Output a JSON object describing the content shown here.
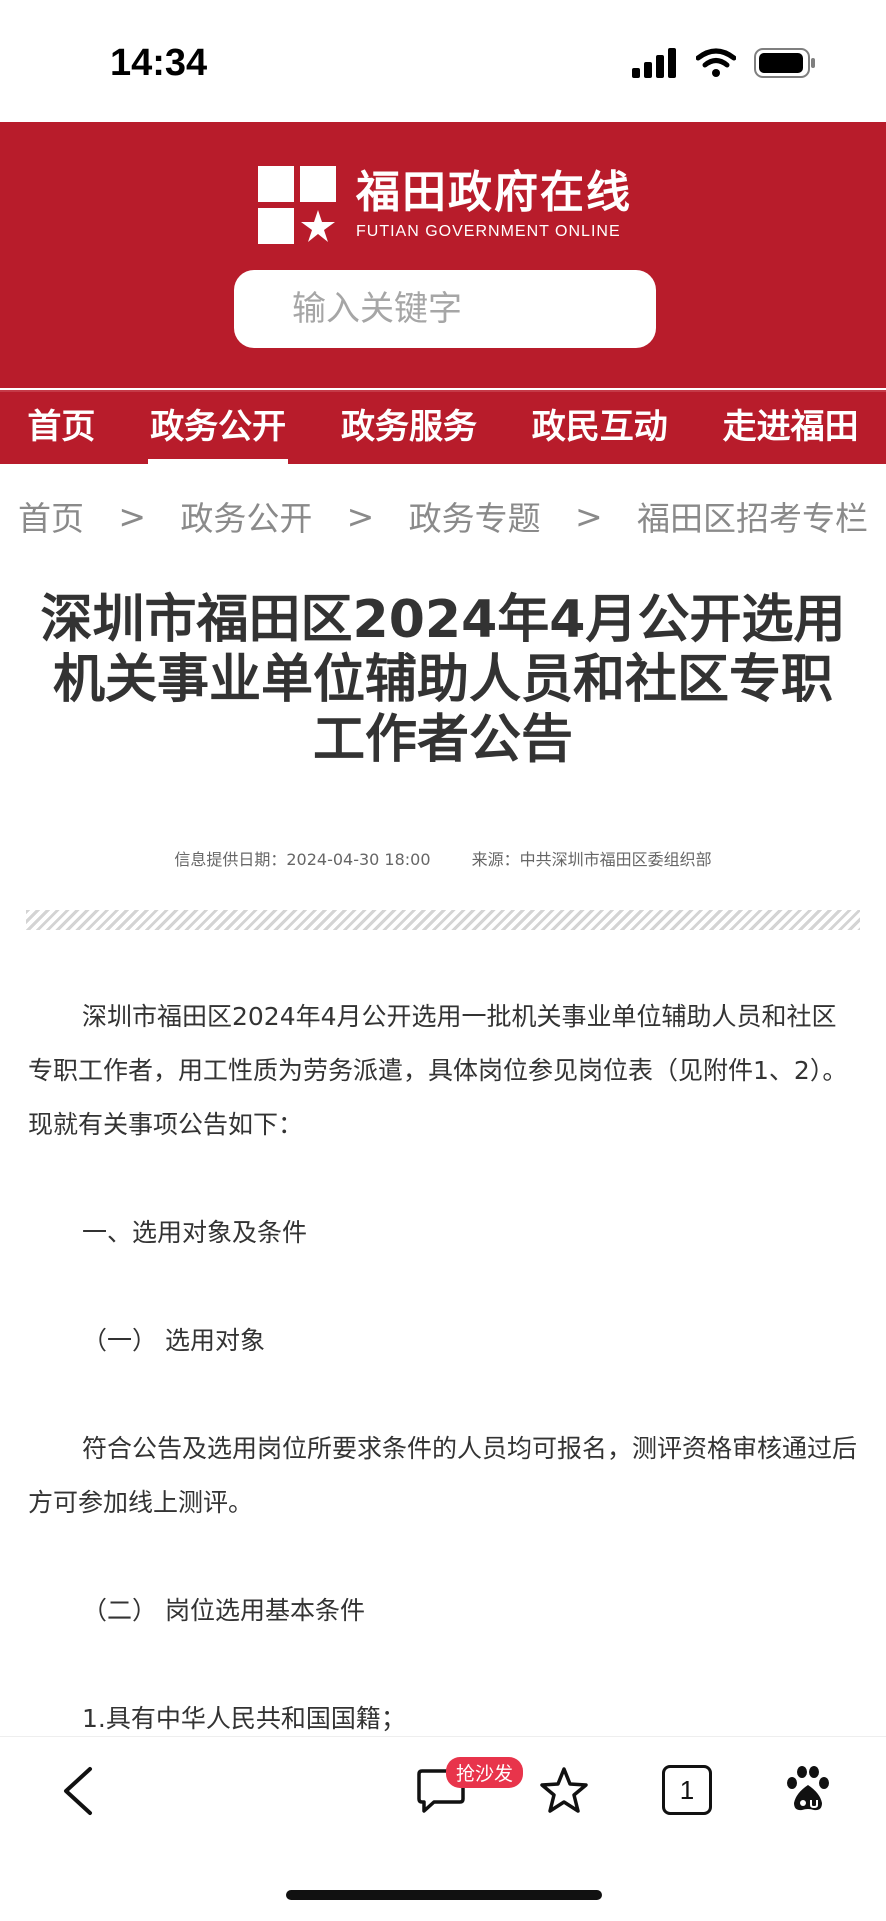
{
  "status_bar": {
    "time": "14:34"
  },
  "site": {
    "name_cn": "福田政府在线",
    "name_en": "FUTIAN GOVERNMENT ONLINE",
    "brand_color": "#b81c2b"
  },
  "search": {
    "placeholder": "输入关键字"
  },
  "nav": {
    "items": [
      "首页",
      "政务公开",
      "政务服务",
      "政民互动",
      "走进福田"
    ],
    "active": "政务公开"
  },
  "breadcrumb": {
    "items": [
      "首页",
      "政务公开",
      "政务专题",
      "福田区招考专栏"
    ],
    "separator": ">"
  },
  "article": {
    "title_lines": [
      "深圳市福田区2024年4月公开选用",
      "机关事业单位辅助人员和社区专职",
      "工作者公告"
    ],
    "date_label": "信息提供日期：2024-04-30 18:00",
    "source_label": "来源：中共深圳市福田区委组织部",
    "paragraphs": [
      "深圳市福田区2024年4月公开选用一批机关事业单位辅助人员和社区专职工作者，用工性质为劳务派遣，具体岗位参见岗位表（见附件1、2）。现就有关事项公告如下：",
      "一、选用对象及条件",
      "（一） 选用对象",
      "符合公告及选用岗位所要求条件的人员均可报名，测评资格审核通过后方可参加线上测评。",
      "（二） 岗位选用基本条件",
      "1.具有中华人民共和国国籍；"
    ]
  },
  "bottom_bar": {
    "comment_badge": "抢沙发",
    "tab_count": "1",
    "icons": [
      "back-icon",
      "comment-icon",
      "star-icon",
      "tabs-icon",
      "baidu-paw-icon"
    ]
  }
}
